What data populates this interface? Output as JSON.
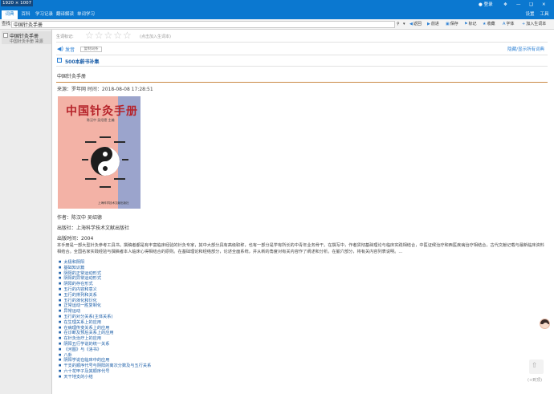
{
  "window": {
    "dimension_label": "1920 × 1007",
    "login_label": "登录",
    "right_menu": {
      "settings": "设置",
      "tools": "工具"
    }
  },
  "menu": {
    "items": [
      {
        "label": "词典",
        "active": true
      },
      {
        "label": "百科",
        "active": false
      },
      {
        "label": "学习记录",
        "active": false
      },
      {
        "label": "翻译解读",
        "active": false
      },
      {
        "label": "单词学习",
        "active": false
      }
    ]
  },
  "search": {
    "label": "查找",
    "value": "中国针灸手册",
    "tools": {
      "back": "返回",
      "forward": "前进",
      "save": "保存",
      "bookmark": "标记",
      "favorite": "收藏",
      "copy": "字体",
      "add_dict": "加入生词本"
    }
  },
  "sidebar": {
    "entry_title": "中国针灸手册",
    "entry_sub": "中国针灸手册   来源"
  },
  "content": {
    "rating_label": "生词标记:",
    "stars": "☆☆☆☆☆",
    "rating_note": "(点击加入生词本)",
    "pronounce_label": "发音",
    "copy_button": "复制词条",
    "toggle_dicts": "隐藏/显示所有词典",
    "dict_name": "500本蔚书补集",
    "entry_title": "中国针灸手册",
    "source": "来源：罗年网 时间：2018-08-08 17:28:51",
    "book_cover": {
      "title": "中国针灸手册",
      "author": "陈汉中  吴绍德  主编",
      "publisher": "上海科学技术文献出版社"
    },
    "author": "作者：陈汉中 吴绍德",
    "publisher": "出版社：上海科学技术文献出版社",
    "publish_date": "出版时间：2004",
    "description": "本手册是一部大型针灸参考工具书。撰稿者都是有丰富临床经验的针灸专家，其中大部分具有高级职称，也有一部分是学有所长的中青年业务骨干。在撰写中，作者贯彻基础理论与临床实践相结合，中医证候治疗和西医疾病治疗相结合，古代文献记载与最新临床资料相结合。全国名家实践经验与撰稿者本人临床心得相结合的原则。在基础理论和经络部分，论述全面系统，并从新的角度对有关内容作了阐述和分析。在腧穴部分，将有关内容列表说明。...",
    "toc": [
      "太极和阴阳",
      "基础知识篇",
      "阴阳的正常运动形式",
      "阴阳的异常运动形式",
      "阴阳的存在形式",
      "五行的内容和意义",
      "五行的排列和关系",
      "五行的演化和衍化",
      "正常运动一胜复制化",
      "异常运动",
      "五行的对分关系(主体关系)",
      "在生理关系上的应用",
      "在病理传变关系上的应用",
      "在诊断及预后关系上的应用",
      "在针灸治疗上的应用",
      "阴阳五行学说的统一关系",
      "《河图》与《洛书》",
      "八卦",
      "阴阳学说在临床中的应用",
      "干支的顺序代号与阴阳的离次分数及与五行关系",
      "六十花甲子及其顺序代号",
      "天干地支的小结"
    ]
  },
  "back_to_top": "(+到顶)"
}
